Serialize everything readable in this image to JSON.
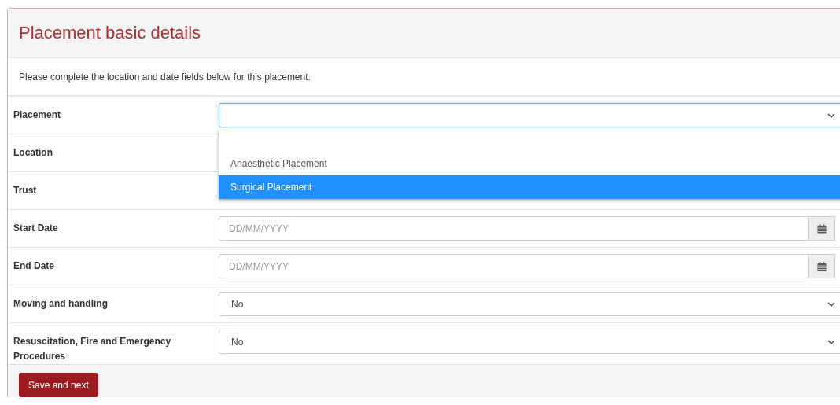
{
  "panel": {
    "title": "Placement basic details",
    "intro": "Please complete the location and date fields below for this placement."
  },
  "rows": [
    {
      "label": "Placement",
      "kind": "select",
      "focused": true,
      "options": [
        {
          "label": "Anaesthetic Placement",
          "selected": false
        },
        {
          "label": "Surgical Placement",
          "selected": true
        }
      ]
    },
    {
      "label": "Location",
      "kind": "hidden"
    },
    {
      "label": "Trust",
      "kind": "hidden"
    },
    {
      "label": "Start Date",
      "kind": "date",
      "placeholder": "DD/MM/YYYY"
    },
    {
      "label": "End Date",
      "kind": "date",
      "placeholder": "DD/MM/YYYY"
    },
    {
      "label": "Moving and handling",
      "kind": "select",
      "value": "No",
      "focused": false
    },
    {
      "label": "Resuscitation, Fire and Emergency Procedures",
      "kind": "select",
      "value": "No",
      "focused": false
    }
  ],
  "footer": {
    "button": "Save and next"
  }
}
